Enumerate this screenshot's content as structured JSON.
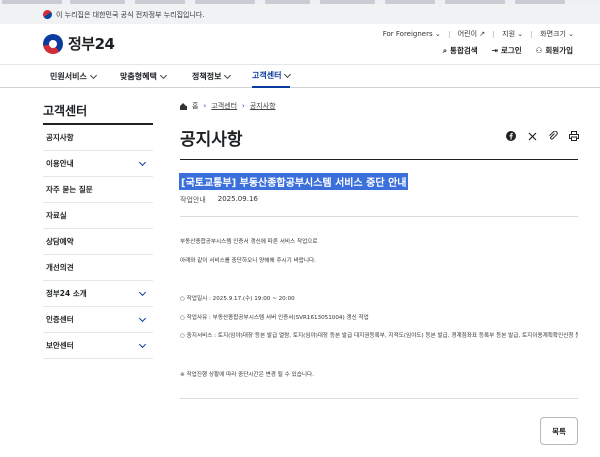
{
  "gov_banner": {
    "text": "이 누리집은 대한민국 공식 전자정부 누리집입니다."
  },
  "logo": {
    "name": "정부24"
  },
  "utility": {
    "foreigners": "For Foreigners",
    "kids": "어린이",
    "support": "지원",
    "font_size": "화면크기"
  },
  "header_actions": {
    "search": "통합검색",
    "login": "로그인",
    "signup": "회원가입"
  },
  "gnb": [
    {
      "label": "민원서비스"
    },
    {
      "label": "맞춤형혜택"
    },
    {
      "label": "정책정보"
    },
    {
      "label": "고객센터",
      "active": true
    }
  ],
  "sidebar": {
    "title": "고객센터",
    "items": [
      {
        "label": "공지사항",
        "has_children": false
      },
      {
        "label": "이용안내",
        "has_children": true
      },
      {
        "label": "자주 묻는 질문",
        "has_children": false
      },
      {
        "label": "자료실",
        "has_children": false
      },
      {
        "label": "상담예약",
        "has_children": false
      },
      {
        "label": "개선의견",
        "has_children": false
      },
      {
        "label": "정부24 소개",
        "has_children": true
      },
      {
        "label": "인증센터",
        "has_children": true
      },
      {
        "label": "보안센터",
        "has_children": true
      }
    ]
  },
  "breadcrumb": {
    "home": "홈",
    "level1": "고객센터",
    "level2": "공지사항"
  },
  "page": {
    "title": "공지사항"
  },
  "share_icons": [
    "facebook-icon",
    "x-icon",
    "link-icon",
    "print-icon"
  ],
  "notice": {
    "title": "[국토교통부] 부동산종합공부시스템 서비스 중단 안내",
    "category": "작업안내",
    "date": "2025.09.16",
    "body": {
      "line1": "부동산종합공부시스템 인증서 갱신에 따른 서비스 작업으로",
      "line2": "아래와 같이 서비스를 중단하오니 양해해 주시기 바랍니다.",
      "schedule": "○ 작업일시 : 2025.9.17.(수) 19:00 ~ 20:00",
      "reason": "○ 작업사유 : 부동산종합공부시스템 서버 인증서(SVR1613051004) 갱신 작업",
      "services": "○ 중지서비스 : 토지(임야)대장 등본 발급 열람, 토지(임야)대장 등본 발급 대지권등록부, 지적도(임야도) 등본 발급, 경계점좌표 등록부 등본 발급, 토지이용계획확인신청 등",
      "note": "※ 작업진행 상황에 따라 중단시간은 변경 될 수 있습니다."
    }
  },
  "list_button": {
    "label": "목록"
  },
  "colors": {
    "primary": "#0b3b9c",
    "selection": "#3b6fdb",
    "text": "#1e2124"
  }
}
